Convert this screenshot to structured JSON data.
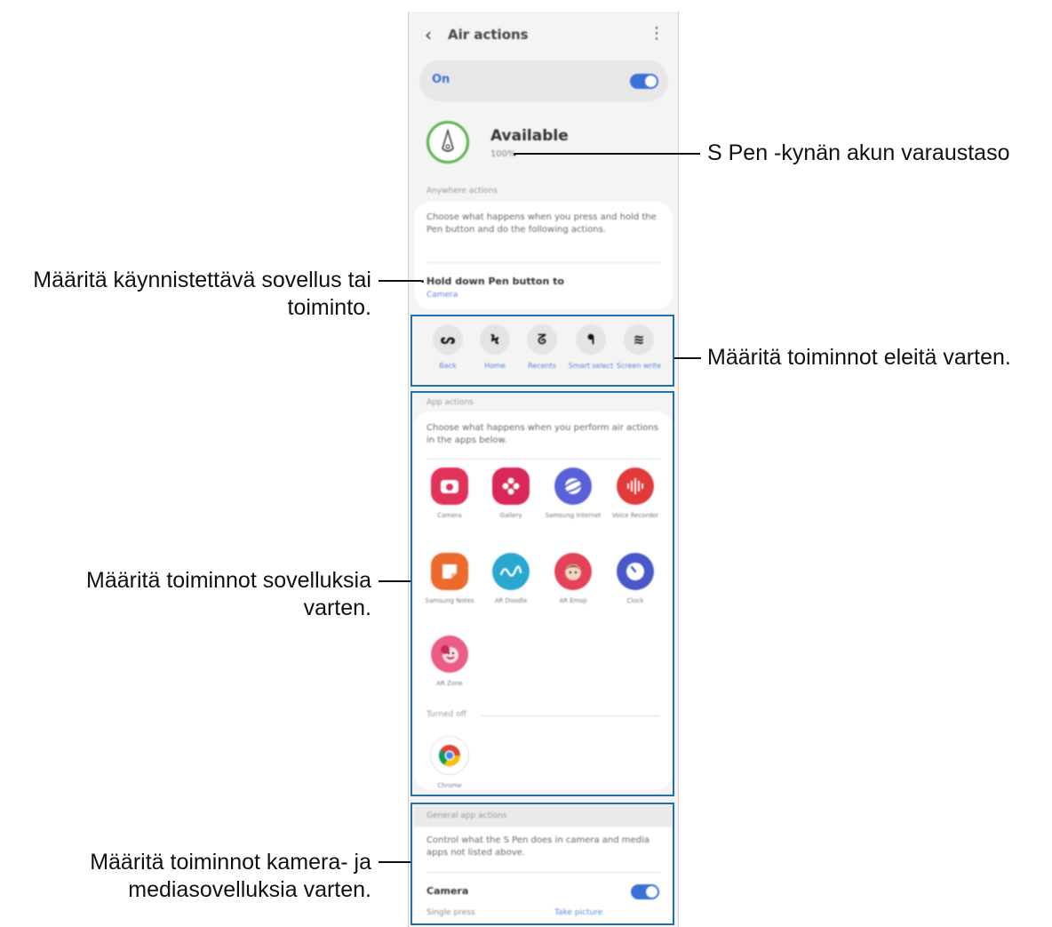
{
  "screen": {
    "title": "Air actions",
    "on_label": "On",
    "pen_status": "Available",
    "battery_level": "100%",
    "anywhere_header": "Anywhere actions",
    "anywhere_desc": "Choose what happens when you press and hold the Pen button and do the following actions.",
    "hold_title": "Hold down Pen button to",
    "hold_value": "Camera",
    "gestures": [
      {
        "glyph": "ᔕ",
        "label": "Back"
      },
      {
        "glyph": "Ϟ",
        "label": "Home"
      },
      {
        "glyph": "ᘔ",
        "label": "Recents"
      },
      {
        "glyph": "ᖳ",
        "label": "Smart select"
      },
      {
        "glyph": "≋",
        "label": "Screen write"
      }
    ],
    "app_actions_header": "App actions",
    "app_actions_desc": "Choose what happens when you perform air actions in the apps below.",
    "apps": [
      {
        "name": "Camera",
        "color": "#e0335a",
        "icon": "camera-app-icon"
      },
      {
        "name": "Gallery",
        "color": "#d8285a",
        "icon": "gallery-app-icon"
      },
      {
        "name": "Samsung Internet",
        "color": "#5961d8",
        "icon": "internet-app-icon"
      },
      {
        "name": "Voice Recorder",
        "color": "#e23a3a",
        "icon": "voice-recorder-app-icon"
      },
      {
        "name": "Samsung Notes",
        "color": "#ec6a2c",
        "icon": "notes-app-icon"
      },
      {
        "name": "AR Doodle",
        "color": "#2aa7cf",
        "icon": "ar-doodle-app-icon"
      },
      {
        "name": "AR Emoji",
        "color": "#e34258",
        "icon": "ar-emoji-app-icon"
      },
      {
        "name": "Clock",
        "color": "#4a57c8",
        "icon": "clock-app-icon"
      },
      {
        "name": "AR Zone",
        "color": "#ec5d86",
        "icon": "ar-zone-app-icon"
      }
    ],
    "turned_off_header": "Turned off",
    "off_apps": [
      {
        "name": "Chrome",
        "icon": "chrome-app-icon"
      }
    ],
    "general_header": "General app actions",
    "general_desc": "Control what the S Pen does in camera and media apps not listed above.",
    "camera_title": "Camera",
    "camera_single": "Single press",
    "camera_take": "Take picture"
  },
  "annotations": {
    "battery": "S Pen -kynän akun varaustaso",
    "app_line1": "Määritä käynnistettävä sovellus tai",
    "app_line2": "toiminto.",
    "gestures": "Määritä toiminnot eleitä varten.",
    "apps_line1": "Määritä toiminnot sovelluksia",
    "apps_line2": "varten.",
    "media_line1": "Määritä toiminnot kamera- ja",
    "media_line2": "mediasovelluksia varten."
  },
  "colors": {
    "accent": "#3a6fd6",
    "highlight_box": "#1f6fb5",
    "pen_ring": "#5db34f"
  }
}
